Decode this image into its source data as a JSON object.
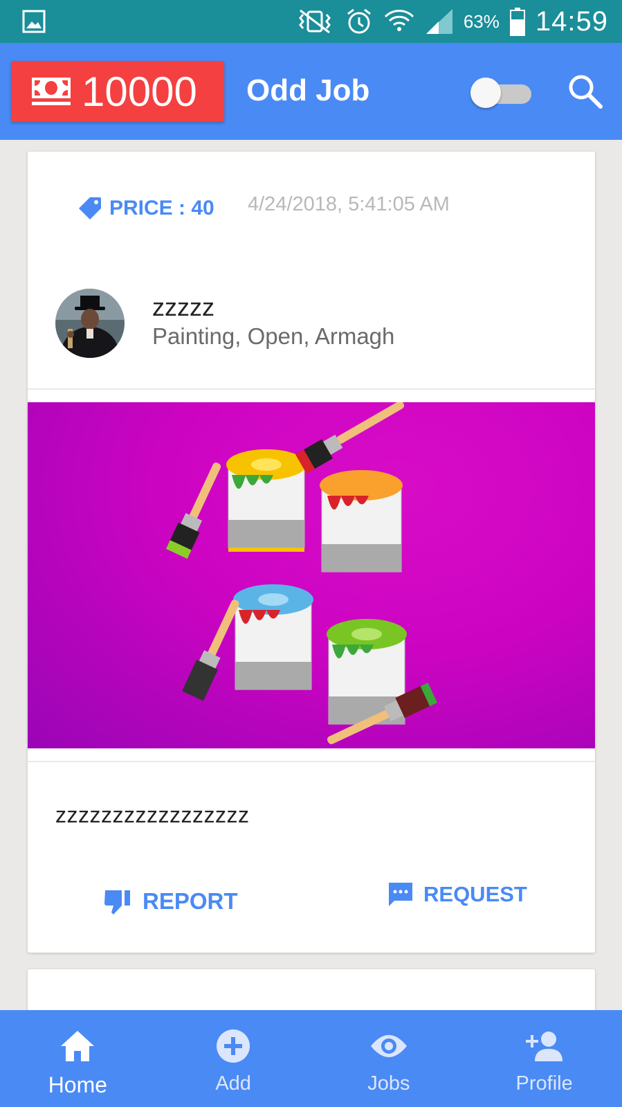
{
  "status_bar": {
    "battery_percent": "63%",
    "time": "14:59"
  },
  "app_bar": {
    "coin_balance": "10000",
    "title": "Odd Job",
    "toggle_on": false
  },
  "job_card": {
    "price_label": "PRICE : 40",
    "date": "4/24/2018, 5:41:05 AM",
    "poster_name": "zzzzz",
    "details": "Painting, Open, Armagh",
    "description": "zzzzzzzzzzzzzzzzz",
    "report_label": "REPORT",
    "request_label": "REQUEST"
  },
  "bottom_nav": {
    "items": [
      {
        "label": "Home",
        "icon": "home-icon",
        "active": true
      },
      {
        "label": "Add",
        "icon": "add-circle-icon",
        "active": false
      },
      {
        "label": "Jobs",
        "icon": "eye-icon",
        "active": false
      },
      {
        "label": "Profile",
        "icon": "person-add-icon",
        "active": false
      }
    ]
  },
  "colors": {
    "status_bar": "#1a8e99",
    "primary": "#4a8af4",
    "coin_badge": "#f44040",
    "image_bg": "#cc04c2"
  }
}
